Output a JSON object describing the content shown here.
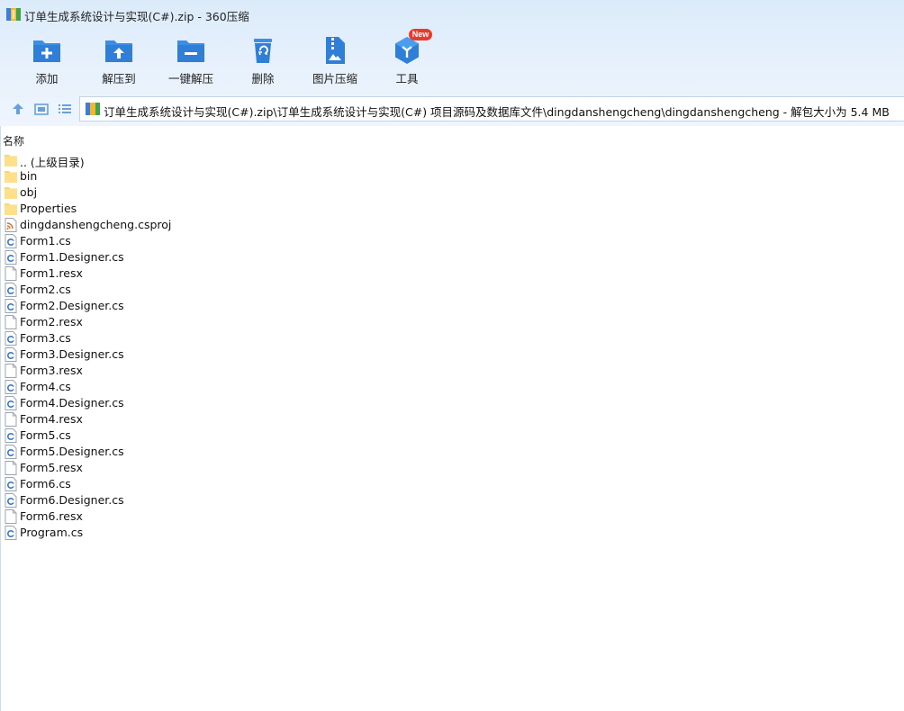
{
  "window": {
    "title": "订单生成系统设计与实现(C#).zip - 360压缩"
  },
  "toolbar": {
    "buttons": [
      {
        "label": "添加",
        "icon": "add-icon"
      },
      {
        "label": "解压到",
        "icon": "extract-to-icon"
      },
      {
        "label": "一键解压",
        "icon": "one-click-extract-icon"
      },
      {
        "label": "删除",
        "icon": "delete-icon"
      },
      {
        "label": "图片压缩",
        "icon": "image-compress-icon"
      },
      {
        "label": "工具",
        "icon": "tools-icon"
      }
    ],
    "new_badge": "New",
    "accent": "#3a8ee6"
  },
  "nav": {
    "path": "订单生成系统设计与实现(C#).zip\\订单生成系统设计与实现(C#) 项目源码及数据库文件\\dingdanshengcheng\\dingdanshengcheng - 解包大小为 5.4 MB"
  },
  "list": {
    "column_name": "名称",
    "rows": [
      {
        "name": ".. (上级目录)",
        "type": "folder"
      },
      {
        "name": "bin",
        "type": "folder"
      },
      {
        "name": "obj",
        "type": "folder"
      },
      {
        "name": "Properties",
        "type": "folder"
      },
      {
        "name": "dingdanshengcheng.csproj",
        "type": "csproj"
      },
      {
        "name": "Form1.cs",
        "type": "cs"
      },
      {
        "name": "Form1.Designer.cs",
        "type": "cs"
      },
      {
        "name": "Form1.resx",
        "type": "file"
      },
      {
        "name": "Form2.cs",
        "type": "cs"
      },
      {
        "name": "Form2.Designer.cs",
        "type": "cs"
      },
      {
        "name": "Form2.resx",
        "type": "file"
      },
      {
        "name": "Form3.cs",
        "type": "cs"
      },
      {
        "name": "Form3.Designer.cs",
        "type": "cs"
      },
      {
        "name": "Form3.resx",
        "type": "file"
      },
      {
        "name": "Form4.cs",
        "type": "cs"
      },
      {
        "name": "Form4.Designer.cs",
        "type": "cs"
      },
      {
        "name": "Form4.resx",
        "type": "file"
      },
      {
        "name": "Form5.cs",
        "type": "cs"
      },
      {
        "name": "Form5.Designer.cs",
        "type": "cs"
      },
      {
        "name": "Form5.resx",
        "type": "file"
      },
      {
        "name": "Form6.cs",
        "type": "cs"
      },
      {
        "name": "Form6.Designer.cs",
        "type": "cs"
      },
      {
        "name": "Form6.resx",
        "type": "file"
      },
      {
        "name": "Program.cs",
        "type": "cs"
      }
    ]
  }
}
